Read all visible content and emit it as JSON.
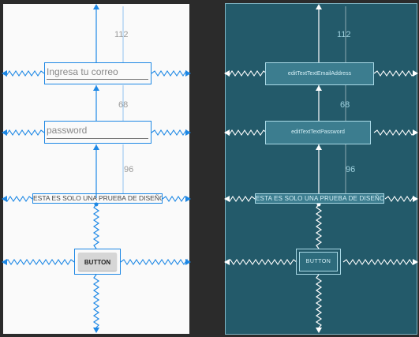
{
  "design": {
    "email_hint": "Ingresa tu correo",
    "password_hint": "password",
    "label_text": "ESTA ES SOLO UNA PRUEBA DE DISEÑO",
    "button_text": "BUTTON",
    "margin_top": "112",
    "margin_email_password": "68",
    "margin_password_label": "96"
  },
  "blueprint": {
    "email_id": "editTextTextEmailAddress",
    "password_id": "editTextTextPassword",
    "label_text": "ESTA ES SOLO UNA PRUEBA DE DISEÑO",
    "button_text": "BUTTON",
    "margin_top": "112",
    "margin_email_password": "68",
    "margin_password_label": "96"
  },
  "colors": {
    "constraint_design": "#1e88e5",
    "constraint_blueprint": "#ffffff",
    "blueprint_bg": "#235a6a",
    "design_bg": "#fafafa"
  }
}
